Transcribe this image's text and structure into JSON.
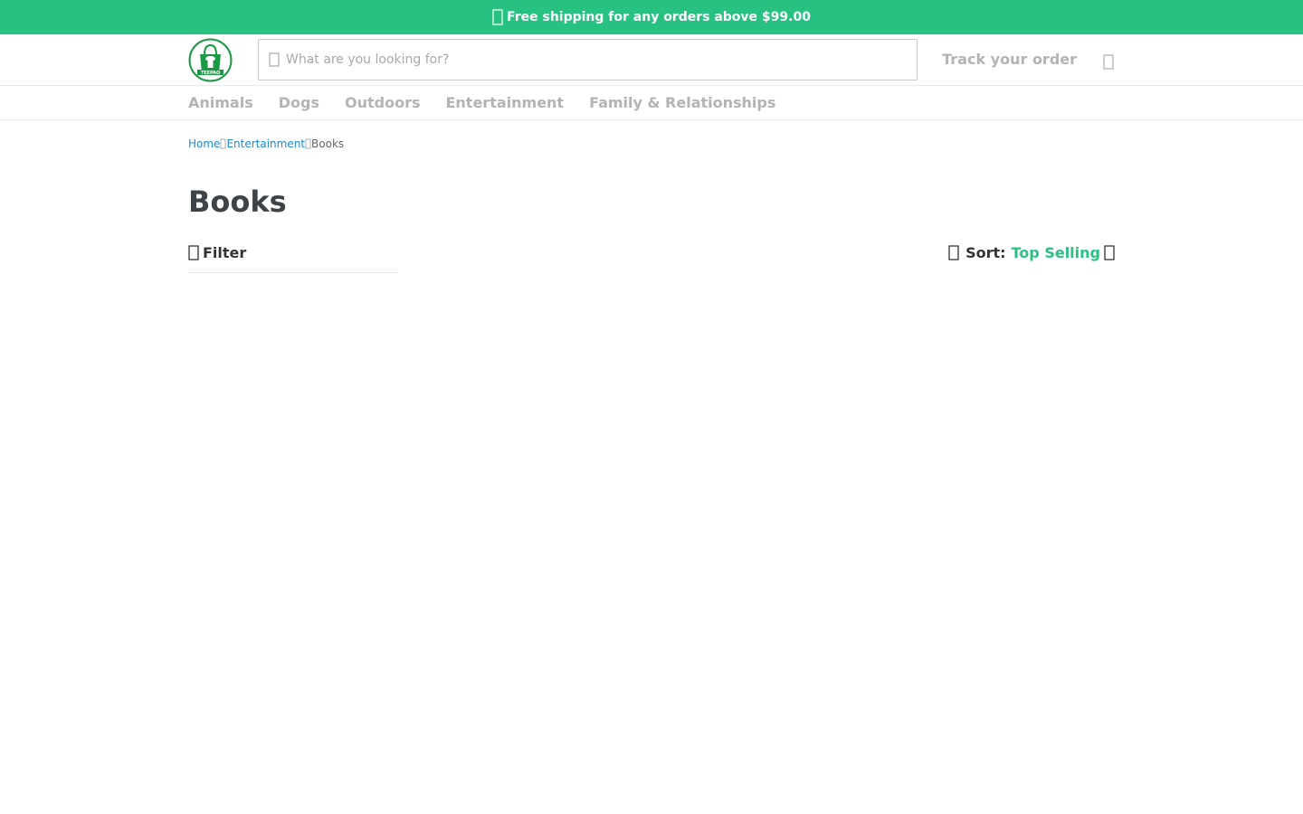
{
  "promo": {
    "text": "Free shipping for any orders above $99.00",
    "icon": "truck-icon"
  },
  "header": {
    "logo_alt": "TEEPAO",
    "search": {
      "placeholder": "What are you looking for?",
      "value": ""
    },
    "track_order_label": "Track your order",
    "cart_icon": "cart-icon"
  },
  "nav": {
    "items": [
      {
        "label": "Animals"
      },
      {
        "label": "Dogs"
      },
      {
        "label": "Outdoors"
      },
      {
        "label": "Entertainment"
      },
      {
        "label": "Family & Relationships"
      }
    ]
  },
  "breadcrumb": {
    "items": [
      {
        "label": "Home",
        "link": true
      },
      {
        "label": "Entertainment",
        "link": true
      },
      {
        "label": "Books",
        "link": false
      }
    ]
  },
  "page": {
    "title": "Books"
  },
  "toolbar": {
    "filter_label": "Filter",
    "sort_label": "Sort:",
    "sort_value": "Top Selling"
  },
  "colors": {
    "brand": "#27c281",
    "link": "#1c8ad4",
    "muted": "#b3b3b3",
    "title": "#3e4348"
  }
}
